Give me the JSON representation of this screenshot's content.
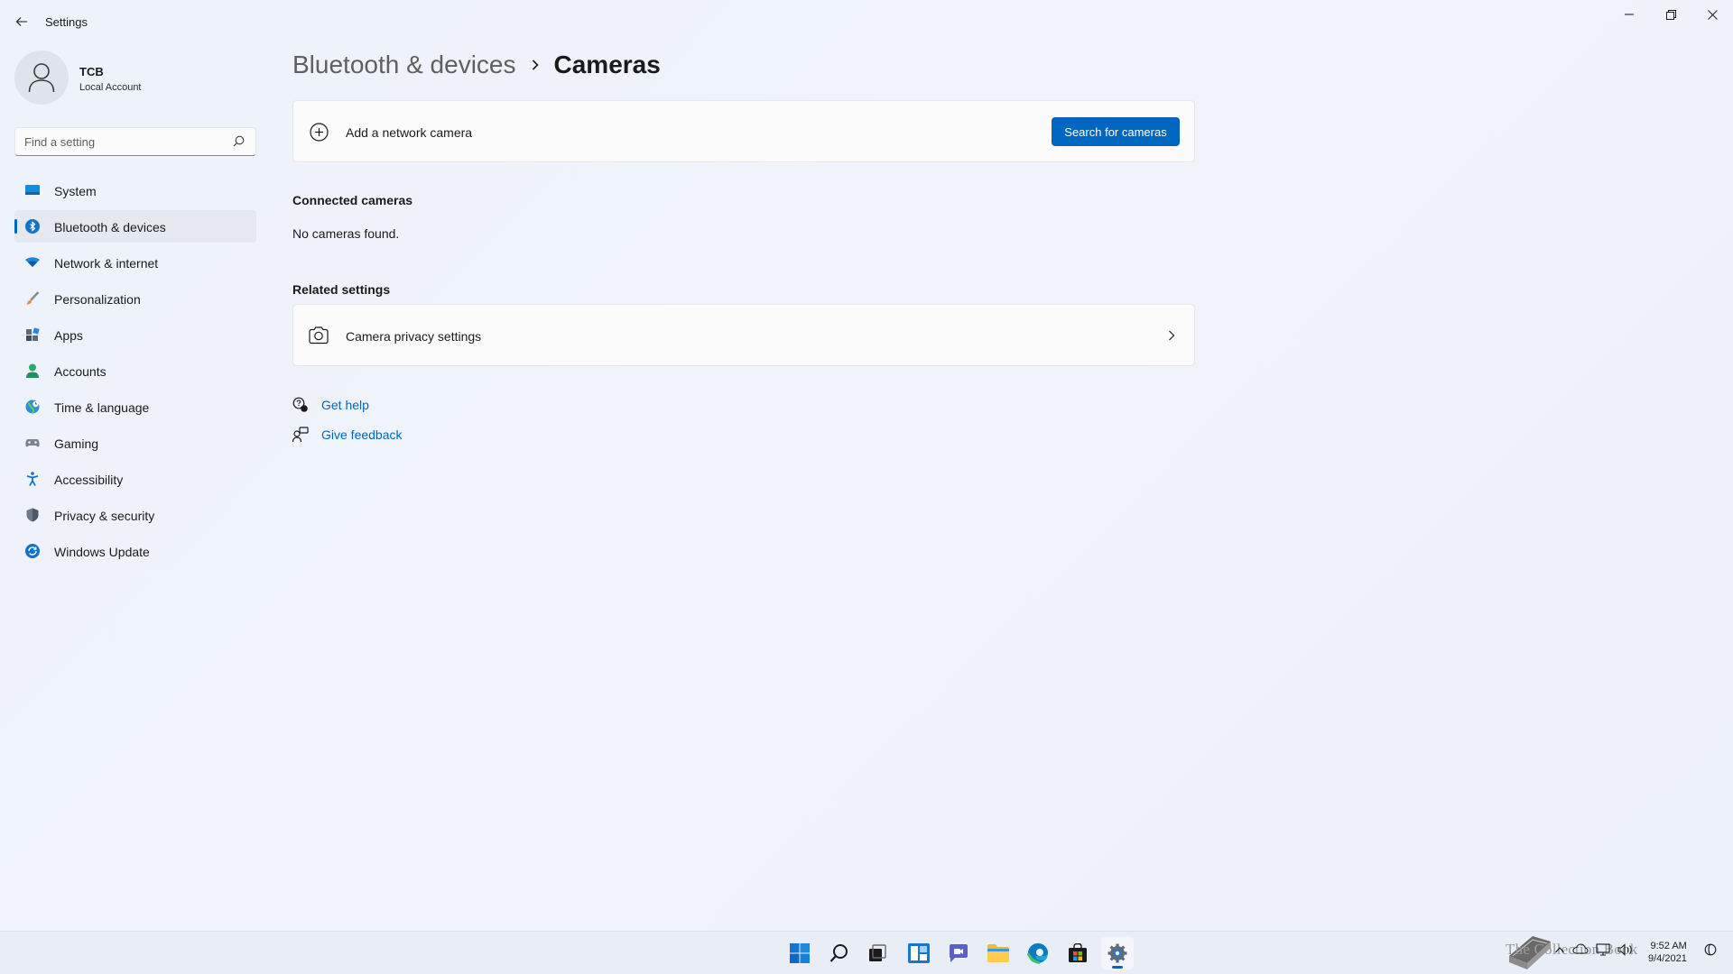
{
  "app": {
    "title": "Settings"
  },
  "profile": {
    "name": "TCB",
    "account_type": "Local Account"
  },
  "search": {
    "placeholder": "Find a setting"
  },
  "nav": {
    "items": [
      {
        "label": "System",
        "icon": "system-icon"
      },
      {
        "label": "Bluetooth & devices",
        "icon": "bluetooth-icon",
        "active": true
      },
      {
        "label": "Network & internet",
        "icon": "wifi-icon"
      },
      {
        "label": "Personalization",
        "icon": "brush-icon"
      },
      {
        "label": "Apps",
        "icon": "apps-icon"
      },
      {
        "label": "Accounts",
        "icon": "person-icon"
      },
      {
        "label": "Time & language",
        "icon": "globe-clock-icon"
      },
      {
        "label": "Gaming",
        "icon": "gamepad-icon"
      },
      {
        "label": "Accessibility",
        "icon": "accessibility-icon"
      },
      {
        "label": "Privacy & security",
        "icon": "shield-icon"
      },
      {
        "label": "Windows Update",
        "icon": "update-icon"
      }
    ]
  },
  "breadcrumb": {
    "parent": "Bluetooth & devices",
    "current": "Cameras"
  },
  "add_camera": {
    "label": "Add a network camera",
    "button": "Search for cameras"
  },
  "connected": {
    "title": "Connected cameras",
    "empty": "No cameras found."
  },
  "related": {
    "title": "Related settings",
    "privacy_label": "Camera privacy settings"
  },
  "help": {
    "get_help": "Get help",
    "feedback": "Give feedback"
  },
  "taskbar": {
    "apps": [
      "start-icon",
      "search-icon",
      "task-view-icon",
      "widgets-icon",
      "chat-icon",
      "file-explorer-icon",
      "edge-icon",
      "store-icon",
      "settings-icon"
    ],
    "active_app": "settings-icon"
  },
  "tray": {
    "watermark": "The Collection Book",
    "time": "9:52 AM",
    "date": "9/4/2021"
  },
  "colors": {
    "accent": "#0067c0",
    "background": "#eef1f8",
    "card": "#fbfbfc"
  }
}
